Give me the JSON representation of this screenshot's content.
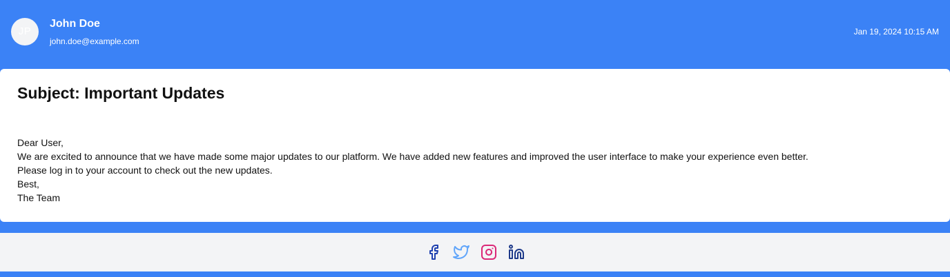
{
  "header": {
    "avatar_initials": "JP",
    "sender_name": "John Doe",
    "sender_email": "john.doe@example.com",
    "timestamp": "Jan 19, 2024 10:15 AM"
  },
  "email": {
    "subject": "Subject: Important Updates",
    "body_lines": [
      "Dear User,",
      "We are excited to announce that we have made some major updates to our platform. We have added new features and improved the user interface to make your experience even better.",
      "Please log in to your account to check out the new updates.",
      "Best,",
      "The Team"
    ]
  },
  "footer": {
    "social_links": [
      {
        "icon": "facebook-icon",
        "color": "#1e40af"
      },
      {
        "icon": "twitter-icon",
        "color": "#60a5fa"
      },
      {
        "icon": "instagram-icon",
        "color": "#db2777"
      },
      {
        "icon": "linkedin-icon",
        "color": "#1e3a8a"
      }
    ]
  },
  "colors": {
    "primary": "#3b82f6",
    "card": "#ffffff",
    "footer": "#f3f4f6"
  }
}
